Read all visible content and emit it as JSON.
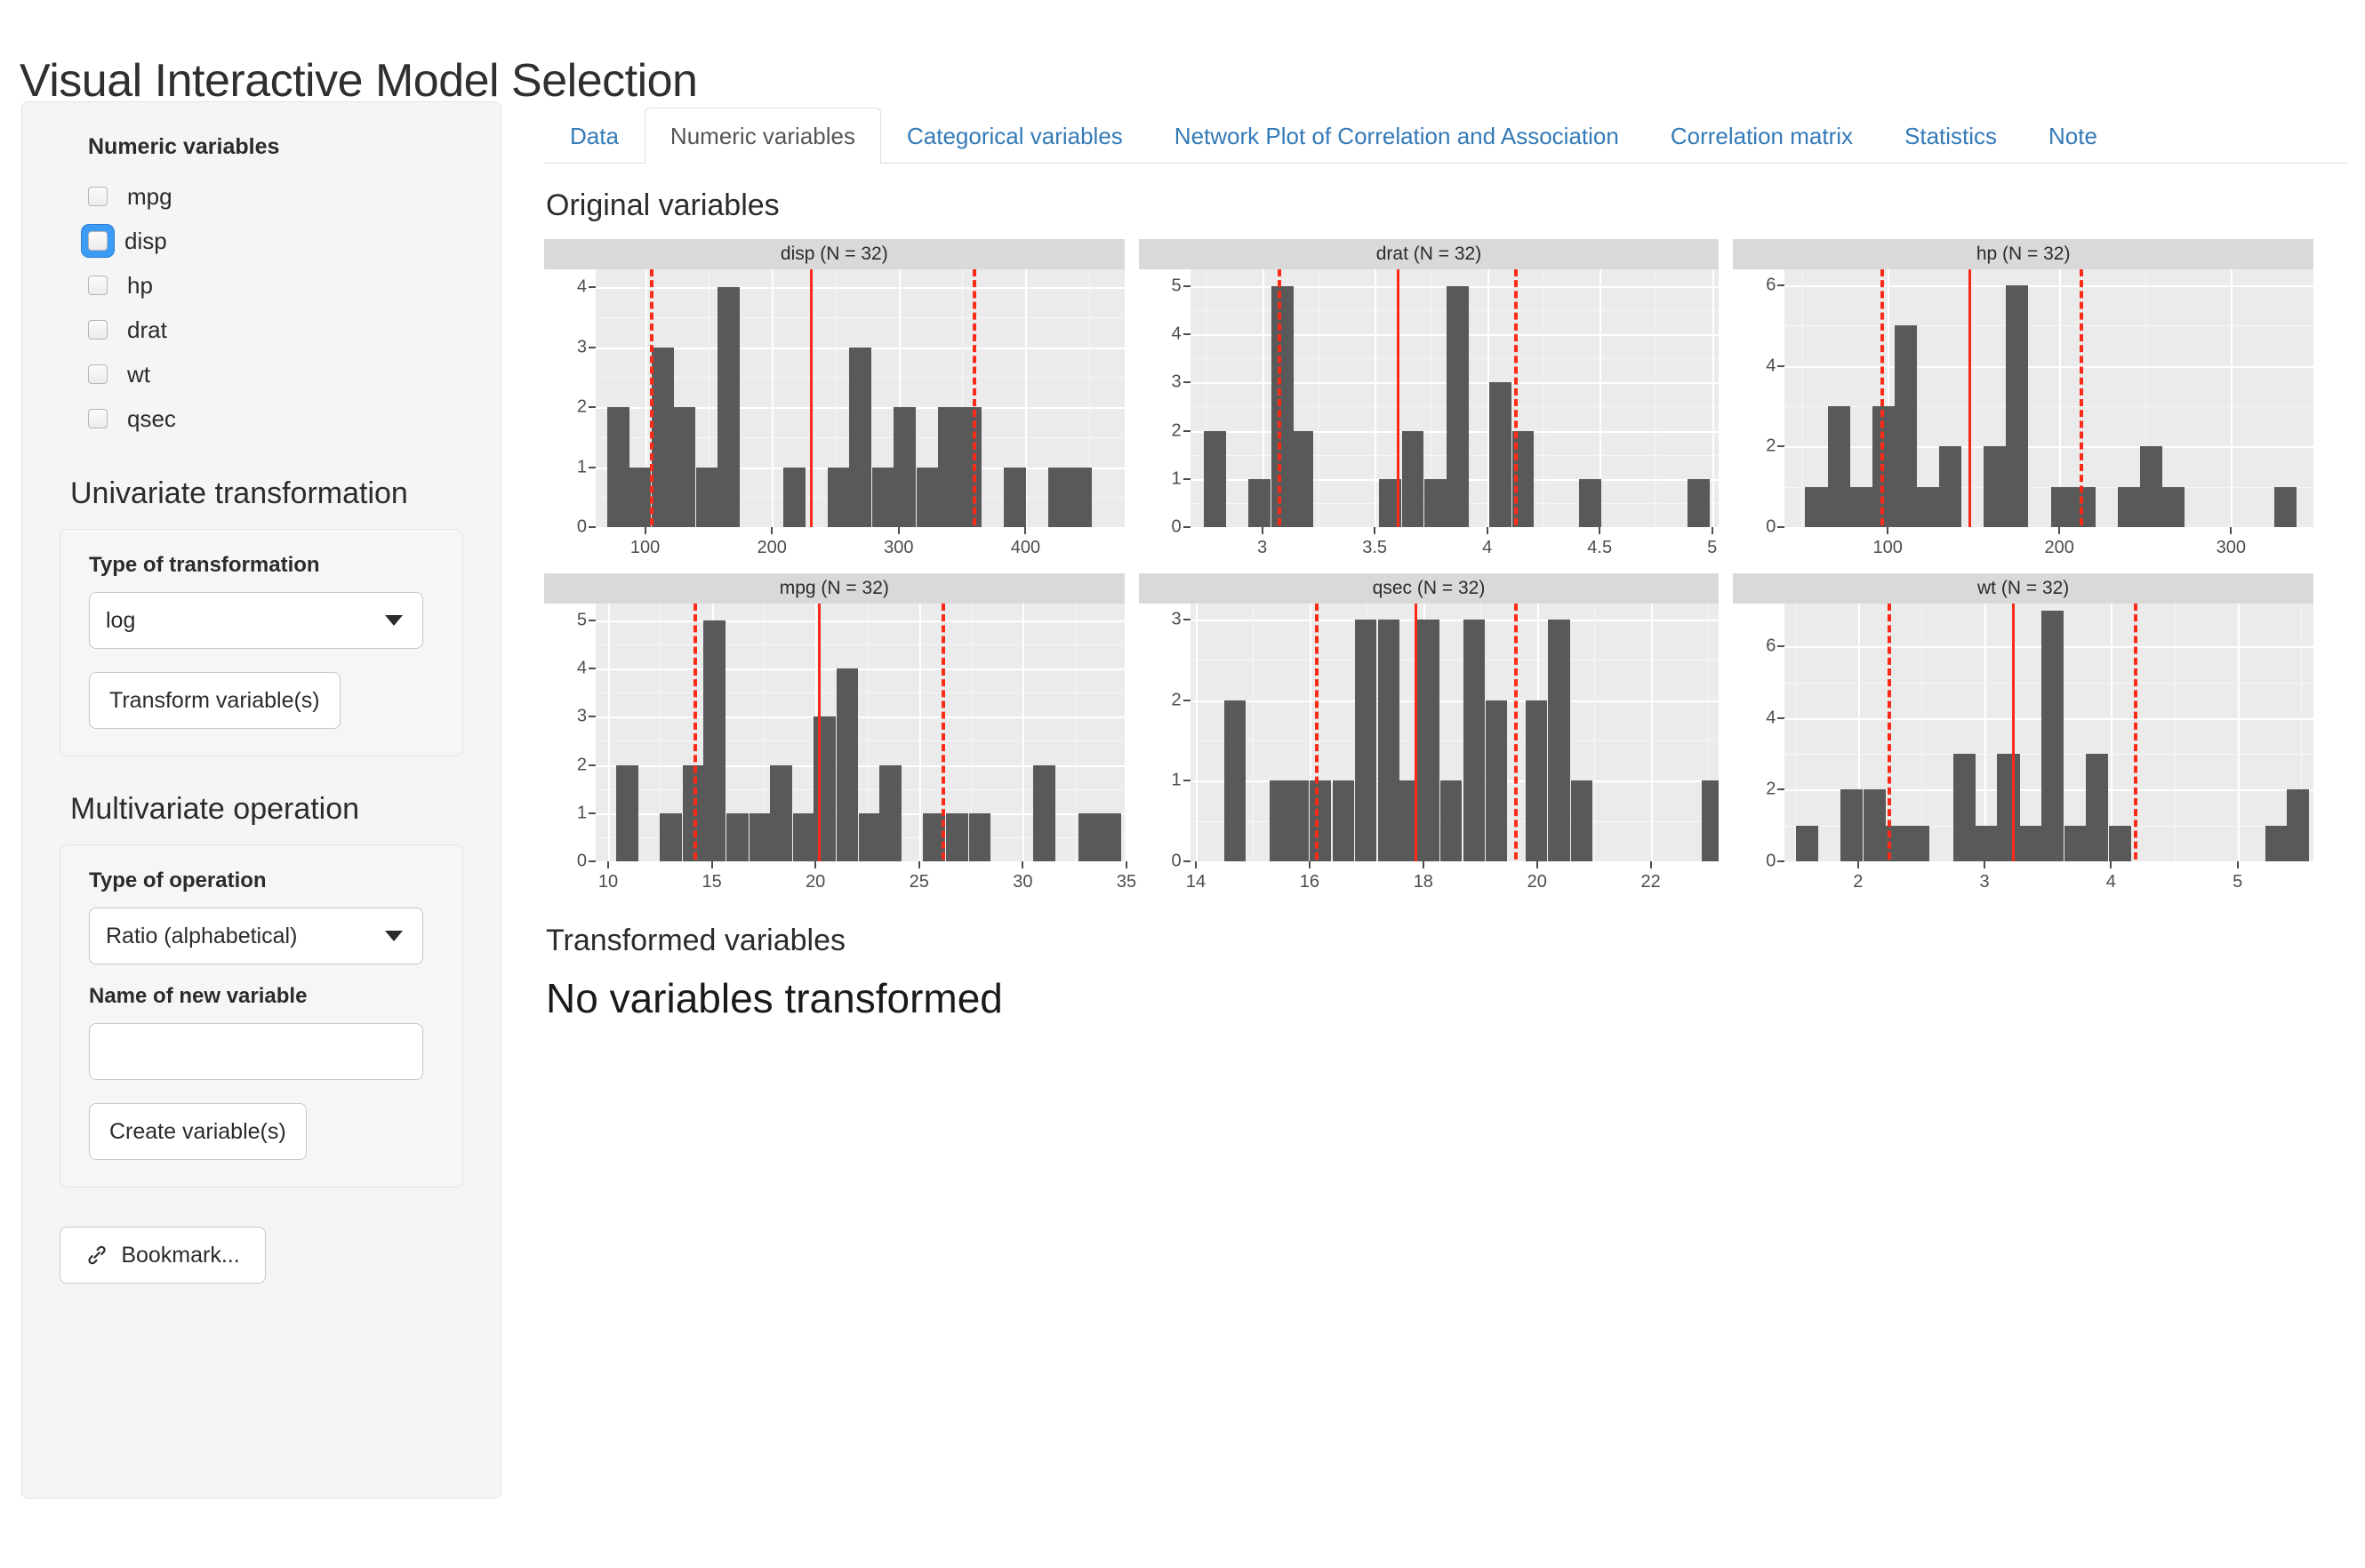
{
  "app": {
    "title": "Visual Interactive Model Selection"
  },
  "sidebar": {
    "numeric_variables_heading": "Numeric variables",
    "variables": [
      {
        "label": "mpg",
        "checked": false,
        "focused": false
      },
      {
        "label": "disp",
        "checked": false,
        "focused": true
      },
      {
        "label": "hp",
        "checked": false,
        "focused": false
      },
      {
        "label": "drat",
        "checked": false,
        "focused": false
      },
      {
        "label": "wt",
        "checked": false,
        "focused": false
      },
      {
        "label": "qsec",
        "checked": false,
        "focused": false
      }
    ],
    "univariate": {
      "section_title": "Univariate transformation",
      "type_label": "Type of transformation",
      "type_value": "log",
      "button_label": "Transform variable(s)"
    },
    "multivariate": {
      "section_title": "Multivariate operation",
      "type_label": "Type of operation",
      "type_value": "Ratio (alphabetical)",
      "name_label": "Name of new variable",
      "name_value": "",
      "name_placeholder": "",
      "button_label": "Create variable(s)"
    },
    "bookmark_label": "Bookmark...",
    "bookmark_icon": "link-icon"
  },
  "main": {
    "tabs": [
      {
        "label": "Data",
        "active": false
      },
      {
        "label": "Numeric variables",
        "active": true
      },
      {
        "label": "Categorical variables",
        "active": false
      },
      {
        "label": "Network Plot of Correlation and Association",
        "active": false
      },
      {
        "label": "Correlation matrix",
        "active": false
      },
      {
        "label": "Statistics",
        "active": false
      },
      {
        "label": "Note",
        "active": false
      }
    ],
    "original_variables_label": "Original variables",
    "transformed_variables_label": "Transformed variables",
    "no_transformed_message": "No variables transformed"
  },
  "colors": {
    "accent_link": "#337ab7",
    "bar_fill": "#595959",
    "reference_line": "#fb2b18",
    "panel_bg": "#ebebeb",
    "strip_bg": "#d9d9d9",
    "checkbox_focus": "#3b9bf5"
  },
  "chart_data": [
    {
      "type": "bar",
      "title": "disp (N = 32)",
      "variable": "disp",
      "n": 32,
      "xlabel": "",
      "ylabel": "",
      "xlim": [
        61,
        478
      ],
      "ylim": [
        0,
        4.3
      ],
      "xticks": [
        100,
        200,
        300,
        400
      ],
      "yticks": [
        0,
        1,
        2,
        3,
        4
      ],
      "grid": true,
      "bin_width": 17.4,
      "bin_starts": [
        70,
        87,
        105,
        122,
        140,
        157,
        174,
        192,
        209,
        227,
        244,
        261,
        279,
        296,
        314,
        331,
        348,
        366,
        383,
        401,
        418,
        435,
        453
      ],
      "values": [
        2,
        1,
        3,
        2,
        1,
        4,
        0,
        0,
        1,
        0,
        1,
        3,
        1,
        2,
        1,
        2,
        2,
        0,
        1,
        0,
        1,
        1,
        0
      ],
      "reference_lines": [
        {
          "value": 104,
          "style": "dashed",
          "meaning": "lower quartile"
        },
        {
          "value": 230,
          "style": "solid",
          "meaning": "mean"
        },
        {
          "value": 358,
          "style": "dashed",
          "meaning": "upper quartile"
        }
      ]
    },
    {
      "type": "bar",
      "title": "drat (N = 32)",
      "variable": "drat",
      "n": 32,
      "xlabel": "",
      "ylabel": "",
      "xlim": [
        2.68,
        5.03
      ],
      "ylim": [
        0,
        5.35
      ],
      "xticks": [
        3.0,
        3.5,
        4.0,
        4.5,
        5.0
      ],
      "yticks": [
        0,
        1,
        2,
        3,
        4,
        5
      ],
      "grid": true,
      "bin_width": 0.098,
      "bin_starts": [
        2.74,
        2.84,
        2.94,
        3.04,
        3.13,
        3.23,
        3.33,
        3.43,
        3.52,
        3.62,
        3.72,
        3.82,
        3.92,
        4.01,
        4.11,
        4.21,
        4.31,
        4.41,
        4.5,
        4.6,
        4.7,
        4.8,
        4.89
      ],
      "values": [
        2,
        0,
        1,
        5,
        2,
        0,
        0,
        0,
        1,
        2,
        1,
        5,
        0,
        3,
        2,
        0,
        0,
        1,
        0,
        0,
        0,
        0,
        1
      ],
      "reference_lines": [
        {
          "value": 3.07,
          "style": "dashed",
          "meaning": "lower quartile"
        },
        {
          "value": 3.6,
          "style": "solid",
          "meaning": "mean"
        },
        {
          "value": 4.12,
          "style": "dashed",
          "meaning": "upper quartile"
        }
      ]
    },
    {
      "type": "bar",
      "title": "hp (N = 32)",
      "variable": "hp",
      "n": 32,
      "xlabel": "",
      "ylabel": "",
      "xlim": [
        40,
        348
      ],
      "ylim": [
        0,
        6.4
      ],
      "xticks": [
        100,
        200,
        300
      ],
      "yticks": [
        0,
        2,
        4,
        6
      ],
      "grid": true,
      "bin_width": 13,
      "bin_starts": [
        52,
        65,
        78,
        91,
        104,
        117,
        130,
        143,
        156,
        169,
        182,
        195,
        208,
        221,
        234,
        247,
        260,
        273,
        286,
        299,
        312,
        325
      ],
      "values": [
        1,
        3,
        1,
        3,
        5,
        1,
        2,
        0,
        2,
        6,
        0,
        1,
        1,
        0,
        1,
        2,
        1,
        0,
        0,
        0,
        0,
        1
      ],
      "reference_lines": [
        {
          "value": 96,
          "style": "dashed",
          "meaning": "lower quartile"
        },
        {
          "value": 147,
          "style": "solid",
          "meaning": "mean"
        },
        {
          "value": 212,
          "style": "dashed",
          "meaning": "upper quartile"
        }
      ]
    },
    {
      "type": "bar",
      "title": "mpg (N = 32)",
      "variable": "mpg",
      "n": 32,
      "xlabel": "",
      "ylabel": "",
      "xlim": [
        9.4,
        34.9
      ],
      "ylim": [
        0,
        5.35
      ],
      "xticks": [
        10,
        15,
        20,
        25,
        30,
        35
      ],
      "yticks": [
        0,
        1,
        2,
        3,
        4,
        5
      ],
      "grid": true,
      "bin_width": 1.06,
      "bin_starts": [
        10.4,
        11.5,
        12.5,
        13.6,
        14.6,
        15.7,
        16.8,
        17.8,
        18.9,
        19.9,
        21.0,
        22.1,
        23.1,
        24.2,
        25.2,
        26.3,
        27.4,
        28.4,
        29.5,
        30.5,
        31.6,
        32.7,
        33.7
      ],
      "values": [
        2,
        0,
        1,
        2,
        5,
        1,
        1,
        2,
        1,
        3,
        4,
        1,
        2,
        0,
        1,
        1,
        1,
        0,
        0,
        2,
        0,
        1,
        1
      ],
      "reference_lines": [
        {
          "value": 14.1,
          "style": "dashed",
          "meaning": "lower quartile"
        },
        {
          "value": 20.1,
          "style": "solid",
          "meaning": "mean"
        },
        {
          "value": 26.1,
          "style": "dashed",
          "meaning": "upper quartile"
        }
      ]
    },
    {
      "type": "bar",
      "title": "qsec (N = 32)",
      "variable": "qsec",
      "n": 32,
      "xlabel": "",
      "ylabel": "",
      "xlim": [
        13.9,
        23.2
      ],
      "ylim": [
        0,
        3.2
      ],
      "xticks": [
        14,
        16,
        18,
        20,
        22
      ],
      "yticks": [
        0,
        1,
        2,
        3
      ],
      "grid": true,
      "bin_width": 0.38,
      "bin_starts": [
        14.5,
        14.9,
        15.3,
        15.6,
        16.0,
        16.4,
        16.8,
        17.2,
        17.5,
        17.9,
        18.3,
        18.7,
        19.1,
        19.4,
        19.8,
        20.2,
        20.6,
        21.0,
        21.3,
        21.7,
        22.1,
        22.5,
        22.9
      ],
      "values": [
        2,
        0,
        1,
        1,
        1,
        1,
        3,
        3,
        1,
        3,
        1,
        3,
        2,
        0,
        2,
        3,
        1,
        0,
        0,
        0,
        0,
        0,
        1
      ],
      "reference_lines": [
        {
          "value": 16.1,
          "style": "dashed",
          "meaning": "lower quartile"
        },
        {
          "value": 17.85,
          "style": "solid",
          "meaning": "mean"
        },
        {
          "value": 19.6,
          "style": "dashed",
          "meaning": "upper quartile"
        }
      ]
    },
    {
      "type": "bar",
      "title": "wt (N = 32)",
      "variable": "wt",
      "n": 32,
      "xlabel": "",
      "ylabel": "",
      "xlim": [
        1.42,
        5.6
      ],
      "ylim": [
        0,
        7.2
      ],
      "xticks": [
        2,
        3,
        4,
        5
      ],
      "yticks": [
        0,
        2,
        4,
        6
      ],
      "grid": true,
      "bin_width": 0.177,
      "bin_starts": [
        1.51,
        1.69,
        1.86,
        2.04,
        2.22,
        2.39,
        2.57,
        2.75,
        2.92,
        3.1,
        3.28,
        3.45,
        3.63,
        3.8,
        3.98,
        4.16,
        4.33,
        4.51,
        4.69,
        4.86,
        5.04,
        5.22,
        5.39
      ],
      "values": [
        1,
        0,
        2,
        2,
        1,
        1,
        0,
        3,
        1,
        3,
        1,
        7,
        1,
        3,
        1,
        0,
        0,
        0,
        0,
        0,
        0,
        1,
        2
      ],
      "reference_lines": [
        {
          "value": 2.23,
          "style": "dashed",
          "meaning": "lower quartile"
        },
        {
          "value": 3.22,
          "style": "solid",
          "meaning": "mean"
        },
        {
          "value": 4.18,
          "style": "dashed",
          "meaning": "upper quartile"
        }
      ]
    }
  ]
}
